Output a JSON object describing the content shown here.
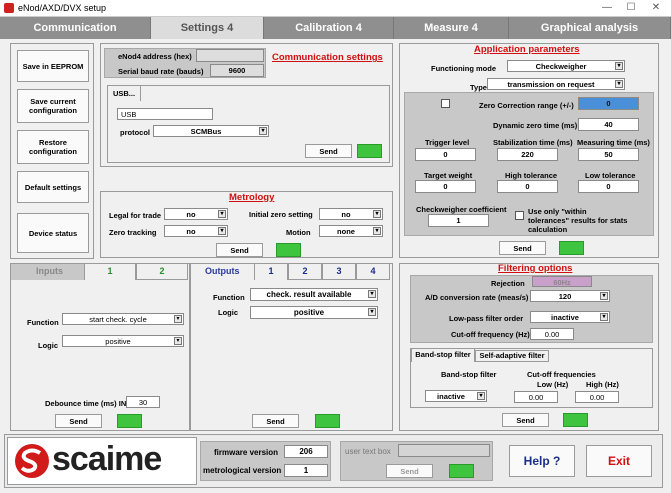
{
  "window": {
    "title": "eNod/AXD/DVX setup",
    "min": "—",
    "max": "☐",
    "close": "✕"
  },
  "tabs": [
    "Communication",
    "Settings 4",
    "Calibration 4",
    "Measure 4",
    "Graphical analysis"
  ],
  "sidebar": [
    "Save in EEPROM",
    "Save current configuration",
    "Restore configuration",
    "Default settings",
    "Device status"
  ],
  "comm": {
    "title": "Communication settings",
    "addr_label": "eNod4 address (hex)",
    "addr": "",
    "baud_label": "Serial baud rate (bauds)",
    "baud": "9600",
    "tab": "USB...",
    "usb_value": "USB",
    "protocol_label": "protocol",
    "protocol": "SCMBus",
    "send": "Send"
  },
  "metro": {
    "title": "Metrology",
    "legal_label": "Legal for trade",
    "legal": "no",
    "init_zero_label": "Initial zero setting",
    "init_zero": "no",
    "zero_track_label": "Zero tracking",
    "zero_track": "no",
    "motion_label": "Motion",
    "motion": "none",
    "send": "Send"
  },
  "app": {
    "title": "Application parameters",
    "mode_label": "Functioning mode",
    "mode": "Checkweigher",
    "type_label": "Type",
    "type": "transmission on request",
    "zero_corr_label": "Zero Correction range (+/-)",
    "zero_corr": "0",
    "dyn_zero_label": "Dynamic zero time (ms)",
    "dyn_zero": "40",
    "trig_label": "Trigger level",
    "trig": "0",
    "stab_label": "Stabilization time (ms)",
    "stab": "220",
    "meas_label": "Measuring time (ms)",
    "meas": "50",
    "target_label": "Target weight",
    "target": "0",
    "hightol_label": "High tolerance",
    "hightol": "0",
    "lowtol_label": "Low tolerance",
    "lowtol": "0",
    "coef_label": "Checkweigher coefficient",
    "coef": "1",
    "within_label": "Use only \"within tolerances\" results for stats calculation",
    "send": "Send"
  },
  "inputs": {
    "title": "Inputs",
    "tabs": [
      "1",
      "2"
    ],
    "function_label": "Function",
    "function": "start check. cycle",
    "logic_label": "Logic",
    "logic": "positive",
    "debounce_label": "Debounce time (ms) IN",
    "debounce": "30",
    "send": "Send"
  },
  "outputs": {
    "title": "Outputs",
    "tabs": [
      "1",
      "2",
      "3",
      "4"
    ],
    "function_label": "Function",
    "function": "check. result available",
    "logic_label": "Logic",
    "logic": "positive",
    "send": "Send"
  },
  "filter": {
    "title": "Filtering options",
    "rejection_label": "Rejection",
    "rejection": "60Hz",
    "adc_label": "A/D conversion rate (meas/s)",
    "adc": "120",
    "lowpass_label": "Low-pass filter order",
    "lowpass": "inactive",
    "cutoff_label": "Cut-off frequency (Hz)",
    "cutoff": "0.00",
    "tabs": [
      "Band-stop filter",
      "Self-adaptive filter"
    ],
    "bs_label": "Band-stop filter",
    "bs": "inactive",
    "cf_label": "Cut-off frequencies",
    "low_label": "Low (Hz)",
    "low": "0.00",
    "high_label": "High (Hz)",
    "high": "0.00",
    "send": "Send"
  },
  "footer": {
    "logo": "scaime",
    "fw_label": "firmware version",
    "fw": "206",
    "metro_label": "metrological version",
    "metro": "1",
    "usertext_label": "user text box",
    "usertext": "",
    "send": "Send",
    "help": "Help ?",
    "exit": "Exit"
  },
  "colors": {
    "accent_red": "#d01010",
    "green": "#3fc43f",
    "tabbar": "#8f8f8f",
    "help": "#1a2f8a"
  }
}
